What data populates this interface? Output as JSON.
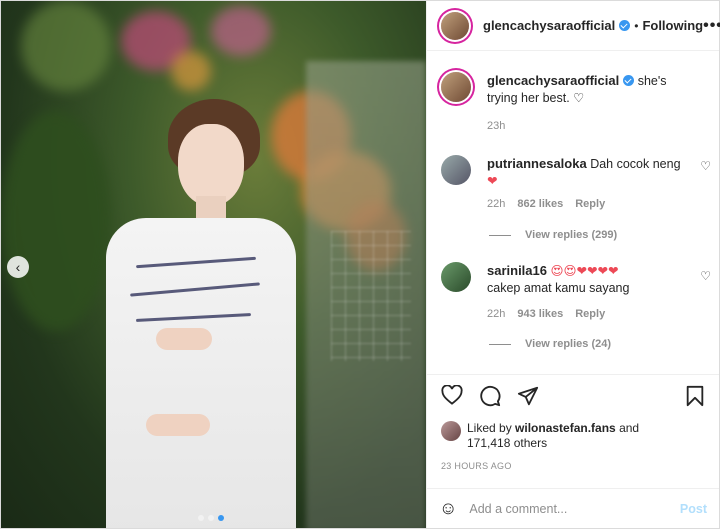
{
  "post": {
    "owner": "glencachysaraofficial",
    "follow_separator": "•",
    "follow_state": "Following",
    "more_icon_glyph": "•••",
    "caption": {
      "username": "glencachysaraofficial",
      "text": "she's trying her best. ♡",
      "time": "23h"
    },
    "comments": [
      {
        "username": "putriannesaloka",
        "text": "Dah cocok neng",
        "emoji": "❤",
        "time": "22h",
        "likes": "862 likes",
        "reply": "Reply",
        "view_replies": "View replies (299)"
      },
      {
        "username": "sarinila16",
        "text": "cakep amat kamu sayang",
        "emoji": "😍😍❤❤❤❤",
        "time": "22h",
        "likes": "943 likes",
        "reply": "Reply",
        "view_replies": "View replies (24)"
      }
    ],
    "liked_by": {
      "prefix": "Liked by",
      "user": "wilonastefan.fans",
      "rest": "and",
      "count": "171,418 others"
    },
    "timestamp": "23 HOURS AGO",
    "add_comment": {
      "placeholder": "Add a comment...",
      "post_label": "Post"
    },
    "icons": {
      "like": "heart-icon",
      "comment": "comment-icon",
      "share": "share-icon",
      "save": "bookmark-icon",
      "emoji": "emoji-icon",
      "prev": "chevron-left-icon"
    },
    "carousel": {
      "count": 3,
      "active": 3
    },
    "colors": {
      "verified": "#3897f0",
      "heart": "#ed4956",
      "post_disabled": "#b2dffc"
    }
  }
}
